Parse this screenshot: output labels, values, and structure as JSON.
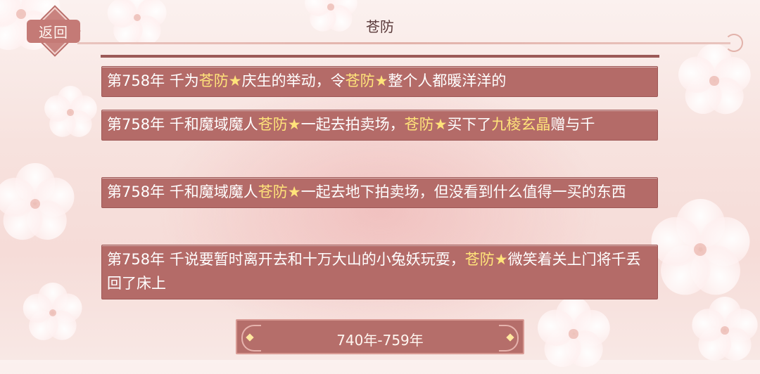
{
  "header": {
    "back_label": "返回",
    "title": "苍防"
  },
  "entries": [
    {
      "segments": [
        {
          "text": "第758年 千为",
          "hl": false
        },
        {
          "text": "苍防",
          "hl": true
        },
        {
          "text": "★",
          "hl": true
        },
        {
          "text": "庆生的举动，令",
          "hl": false
        },
        {
          "text": "苍防",
          "hl": true
        },
        {
          "text": "★",
          "hl": true
        },
        {
          "text": "整个人都暖洋洋的",
          "hl": false
        }
      ]
    },
    {
      "segments": [
        {
          "text": "第758年 千和魔域魔人",
          "hl": false
        },
        {
          "text": "苍防",
          "hl": true
        },
        {
          "text": "★",
          "hl": true
        },
        {
          "text": "一起去拍卖场，",
          "hl": false
        },
        {
          "text": "苍防",
          "hl": true
        },
        {
          "text": "★",
          "hl": true
        },
        {
          "text": "买下了",
          "hl": false
        },
        {
          "text": "九棱玄晶",
          "hl": true
        },
        {
          "text": "赠与千",
          "hl": false
        }
      ]
    },
    {
      "segments": [
        {
          "text": "第758年 千和魔域魔人",
          "hl": false
        },
        {
          "text": "苍防",
          "hl": true
        },
        {
          "text": "★",
          "hl": true
        },
        {
          "text": "一起去地下拍卖场，但没看到什么值得一买的东西",
          "hl": false
        }
      ]
    },
    {
      "segments": [
        {
          "text": "第758年 千说要暂时离开去和十万大山的小兔妖玩耍，",
          "hl": false
        },
        {
          "text": "苍防",
          "hl": true
        },
        {
          "text": "★",
          "hl": true
        },
        {
          "text": "微笑着关上门将千丢回了床上",
          "hl": false
        }
      ]
    }
  ],
  "range_selector": {
    "label": "740年-759年"
  },
  "colors": {
    "highlight": "#ffe37a",
    "entry_bg": "#b46b68",
    "accent": "#c9837f"
  }
}
